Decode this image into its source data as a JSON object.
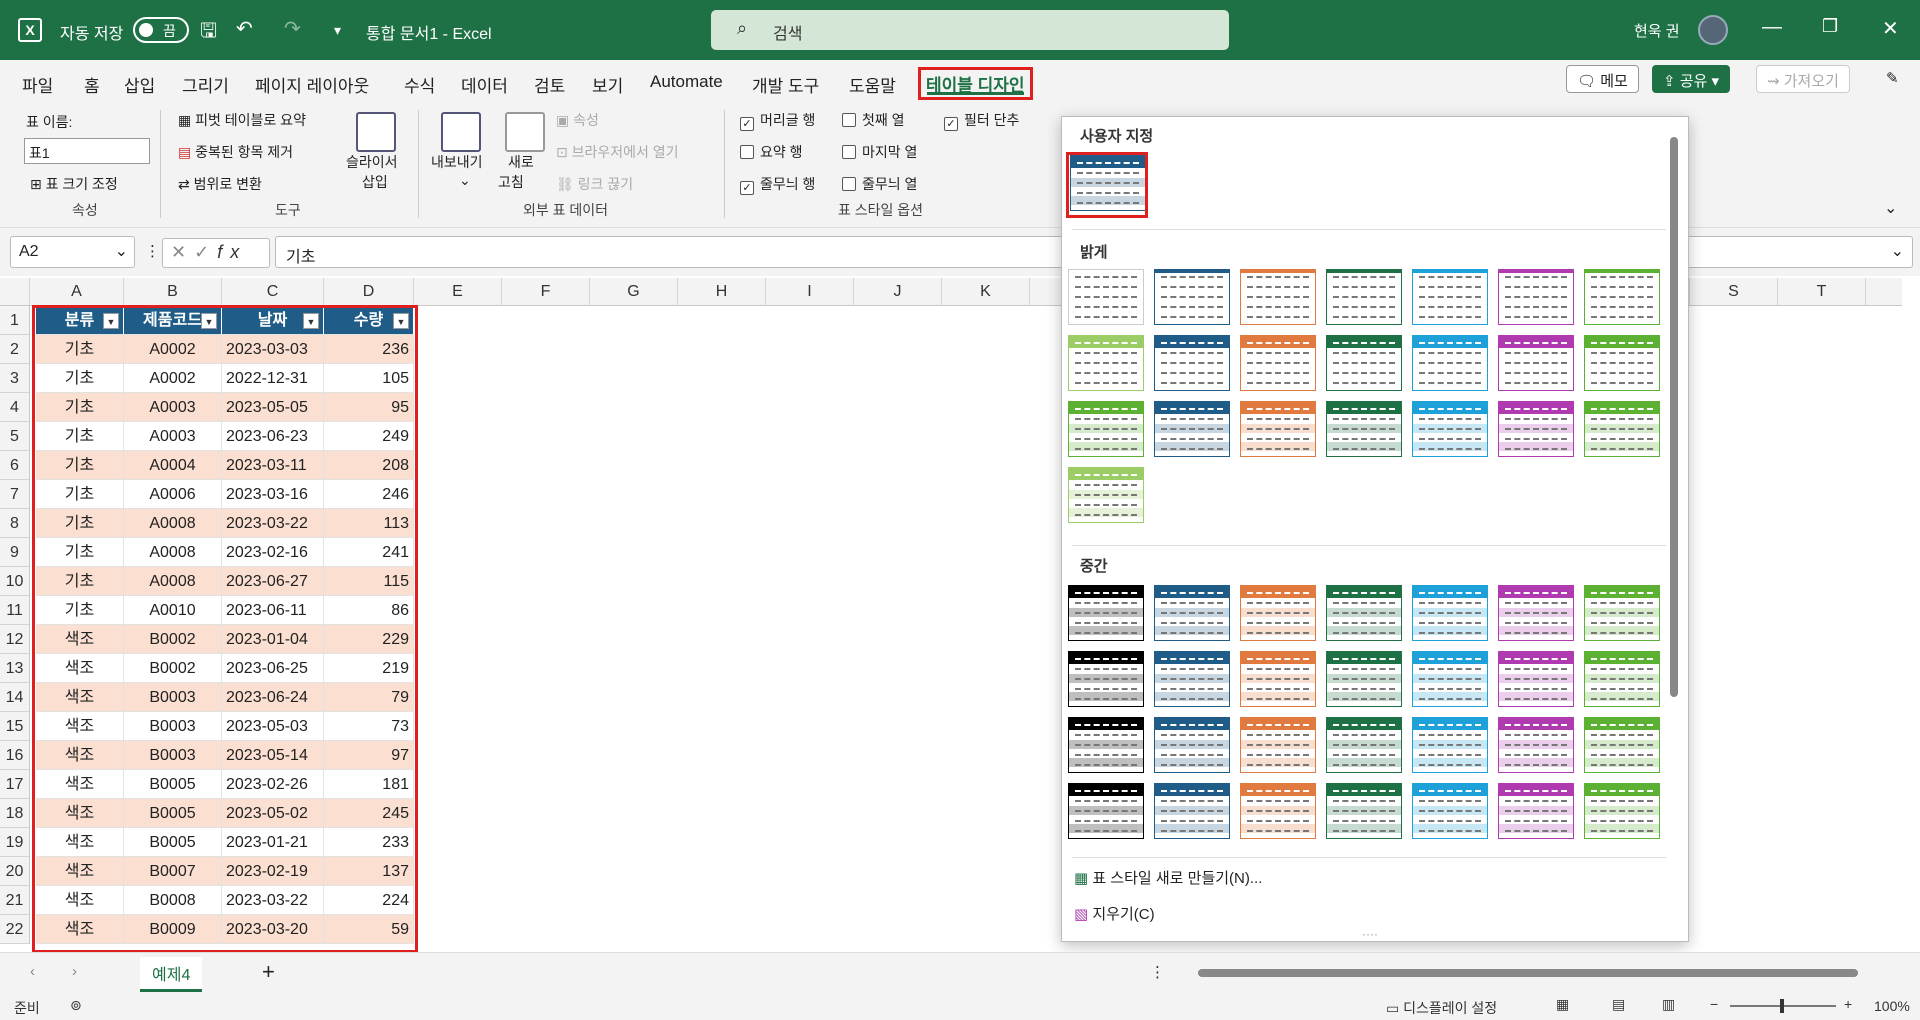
{
  "titlebar": {
    "autosave_label": "자동 저장",
    "autosave_state": "끔",
    "doc_title": "통합 문서1 - Excel",
    "search_placeholder": "검색",
    "user_name": "현욱 권"
  },
  "menu": [
    "파일",
    "홈",
    "삽입",
    "그리기",
    "페이지 레이아웃",
    "수식",
    "데이터",
    "검토",
    "보기",
    "Automate",
    "개발 도구",
    "도움말",
    "테이블 디자인"
  ],
  "menu_right": {
    "memo": "메모",
    "share": "공유",
    "import": "가져오기"
  },
  "ribbon": {
    "props": {
      "name_label": "표 이름:",
      "name_value": "표1",
      "resize": "표 크기 조정",
      "group": "속성"
    },
    "tools": {
      "pivot": "피벗 테이블로 요약",
      "remove_dup": "중복된 항목 제거",
      "convert": "범위로 변환",
      "slicer1": "슬라이서",
      "slicer2": "삽입",
      "group": "도구"
    },
    "external": {
      "export1": "내보내기",
      "refresh1": "새로",
      "refresh2": "고침",
      "props": "속성",
      "open_browser": "브라우저에서 열기",
      "unlink": "링크 끊기",
      "group": "외부 표 데이터"
    },
    "style_opts": {
      "header_row": "머리글 행",
      "first_col": "첫째 열",
      "filter_btn": "필터 단추",
      "total_row": "요약 행",
      "last_col": "마지막 열",
      "banded_rows": "줄무늬 행",
      "banded_cols": "줄무늬 열",
      "group": "표 스타일 옵션"
    },
    "style_opts_state": {
      "header_row": true,
      "first_col": false,
      "filter_btn": true,
      "total_row": false,
      "last_col": false,
      "banded_rows": true,
      "banded_cols": false
    }
  },
  "formula": {
    "cell_ref": "A2",
    "fx": "fx",
    "content": "기초"
  },
  "columns": [
    "A",
    "B",
    "C",
    "D",
    "E",
    "F",
    "G",
    "H",
    "I",
    "J",
    "K",
    "S",
    "T",
    "U"
  ],
  "table": {
    "headers": [
      "분류",
      "제품코드",
      "날짜",
      "수량"
    ],
    "rows": [
      [
        "기초",
        "A0002",
        "2023-03-03",
        "236"
      ],
      [
        "기초",
        "A0002",
        "2022-12-31",
        "105"
      ],
      [
        "기초",
        "A0003",
        "2023-05-05",
        "95"
      ],
      [
        "기초",
        "A0003",
        "2023-06-23",
        "249"
      ],
      [
        "기초",
        "A0004",
        "2023-03-11",
        "208"
      ],
      [
        "기초",
        "A0006",
        "2023-03-16",
        "246"
      ],
      [
        "기초",
        "A0008",
        "2023-03-22",
        "113"
      ],
      [
        "기초",
        "A0008",
        "2023-02-16",
        "241"
      ],
      [
        "기초",
        "A0008",
        "2023-06-27",
        "115"
      ],
      [
        "기초",
        "A0010",
        "2023-06-11",
        "86"
      ],
      [
        "색조",
        "B0002",
        "2023-01-04",
        "229"
      ],
      [
        "색조",
        "B0002",
        "2023-06-25",
        "219"
      ],
      [
        "색조",
        "B0003",
        "2023-06-24",
        "79"
      ],
      [
        "색조",
        "B0003",
        "2023-05-03",
        "73"
      ],
      [
        "색조",
        "B0003",
        "2023-05-14",
        "97"
      ],
      [
        "색조",
        "B0005",
        "2023-02-26",
        "181"
      ],
      [
        "색조",
        "B0005",
        "2023-05-02",
        "245"
      ],
      [
        "색조",
        "B0005",
        "2023-01-21",
        "233"
      ],
      [
        "색조",
        "B0007",
        "2023-02-19",
        "137"
      ],
      [
        "색조",
        "B0008",
        "2023-03-22",
        "224"
      ],
      [
        "색조",
        "B0009",
        "2023-03-20",
        "59"
      ]
    ]
  },
  "gallery": {
    "custom_label": "사용자 지정",
    "light_label": "밝게",
    "medium_label": "중간",
    "new_style": "표 스타일 새로 만들기(N)...",
    "clear": "지우기(C)",
    "palette": [
      "#000000",
      "#1f5c87",
      "#e07a3f",
      "#1e7145",
      "#1ea0d8",
      "#b03ab0",
      "#5cb032"
    ]
  },
  "sheet": {
    "tab": "예제4",
    "add": "+"
  },
  "status": {
    "ready": "준비",
    "display": "디스플레이 설정",
    "zoom": "100%"
  }
}
